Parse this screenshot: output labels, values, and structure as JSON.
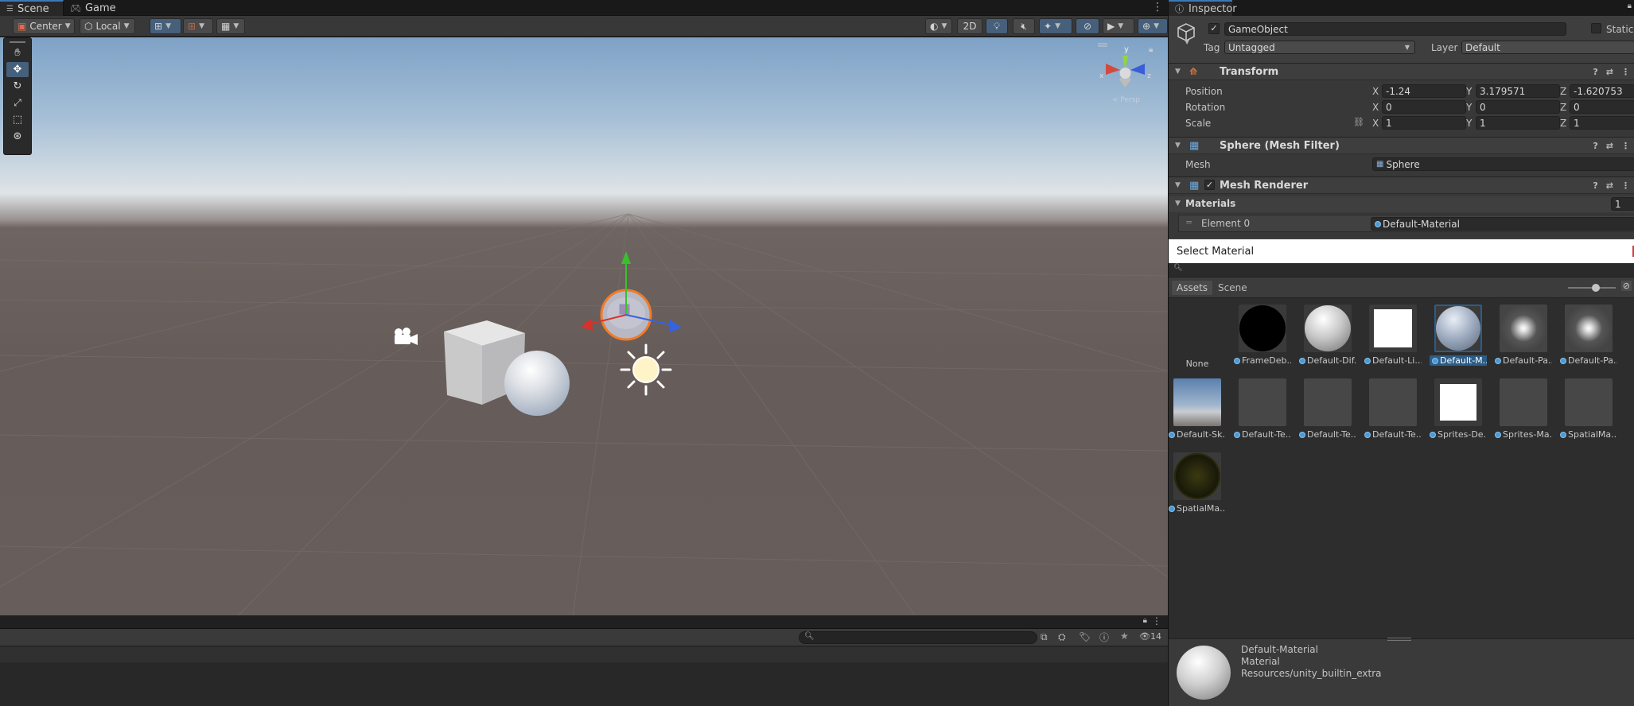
{
  "tabs": {
    "scene": "Scene",
    "game": "Game"
  },
  "toolbar": {
    "pivot": "Center",
    "space": "Local",
    "mode_2d": "2D"
  },
  "console": {
    "count": "14"
  },
  "inspector": {
    "tab": "Inspector",
    "gameobject_name": "GameObject",
    "static_label": "Static",
    "tag_label": "Tag",
    "tag_value": "Untagged",
    "layer_label": "Layer",
    "layer_value": "Default",
    "transform": {
      "title": "Transform",
      "position_label": "Position",
      "rotation_label": "Rotation",
      "scale_label": "Scale",
      "axis_x": "X",
      "axis_y": "Y",
      "axis_z": "Z",
      "position": {
        "x": "-1.24",
        "y": "3.179571",
        "z": "-1.620753"
      },
      "rotation": {
        "x": "0",
        "y": "0",
        "z": "0"
      },
      "scale": {
        "x": "1",
        "y": "1",
        "z": "1"
      }
    },
    "mesh_filter": {
      "title": "Sphere (Mesh Filter)",
      "mesh_label": "Mesh",
      "mesh_value": "Sphere"
    },
    "mesh_renderer": {
      "title": "Mesh Renderer",
      "materials_label": "Materials",
      "materials_count": "1",
      "element_label": "Element 0",
      "element_value": "Default-Material"
    }
  },
  "select_material": {
    "title": "Select Material",
    "tab_assets": "Assets",
    "tab_scene": "Scene",
    "items": [
      "None",
      "FrameDeb...",
      "Default-Dif...",
      "Default-Li...",
      "Default-M...",
      "Default-Pa...",
      "Default-Pa...",
      "Default-Sk...",
      "Default-Te...",
      "Default-Te...",
      "Default-Te...",
      "Sprites-De...",
      "Sprites-Ma...",
      "SpatialMa...",
      "SpatialMa..."
    ],
    "preview": {
      "name": "Default-Material",
      "type": "Material",
      "path": "Resources/unity_builtin_extra"
    }
  },
  "colors": {
    "accent": "#3a79bb",
    "selection": "#2c5d87",
    "toolbar_active": "#46607c"
  }
}
